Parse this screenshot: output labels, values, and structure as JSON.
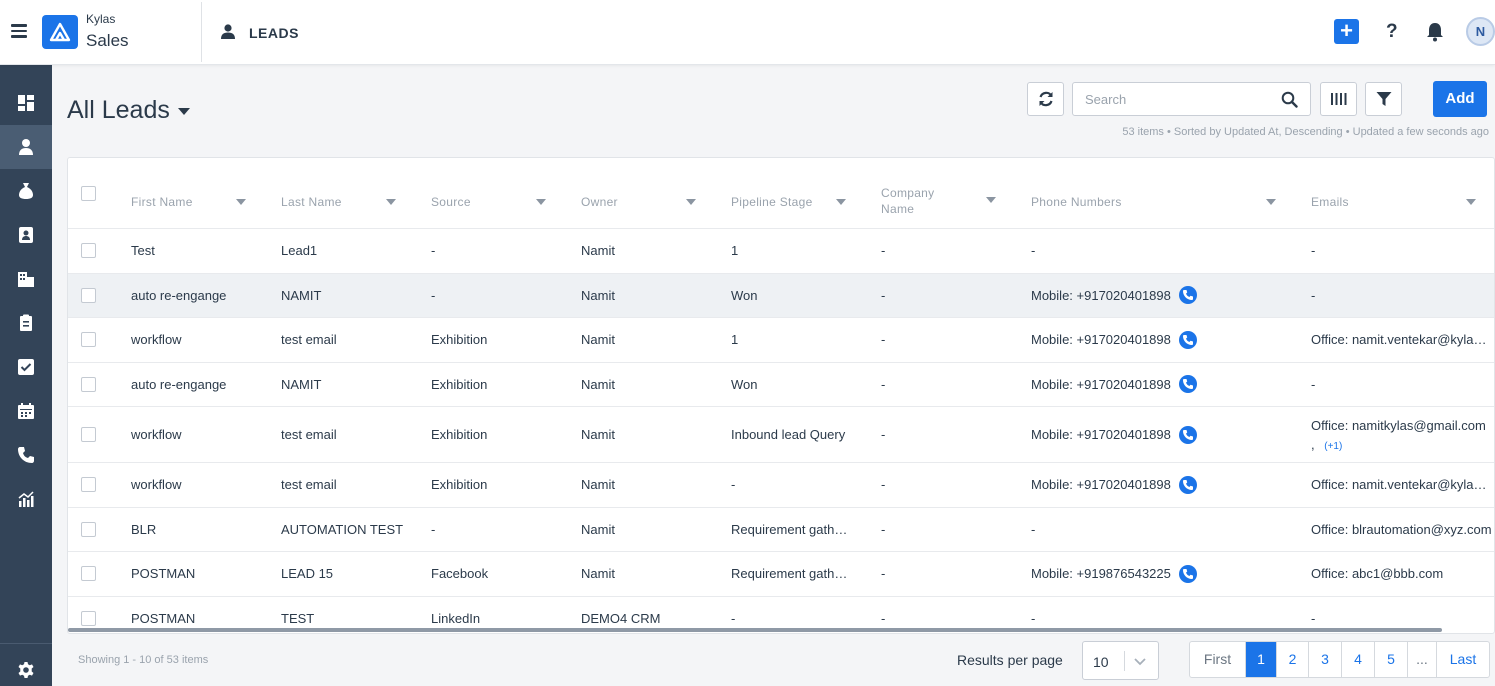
{
  "app": {
    "brand_top": "Kylas",
    "brand_bottom": "Sales",
    "module_title": "LEADS",
    "avatar_initial": "N"
  },
  "icons": {
    "menu": "hamburger-icon",
    "logo": "kylas-logo",
    "module": "person-icon",
    "quick_add": "plus-icon",
    "help": "question-icon",
    "notifications": "bell-icon",
    "refresh": "refresh-icon",
    "search": "search-icon",
    "columns": "columns-icon",
    "filter": "filter-icon",
    "phone": "phone-icon"
  },
  "colors": {
    "accent": "#1b74e8",
    "sidebar": "#334458",
    "sidebar_active": "#4a5d73"
  },
  "sidebar": {
    "items": [
      {
        "icon": "dashboard-icon"
      },
      {
        "icon": "leads-icon",
        "active": true
      },
      {
        "icon": "deals-icon"
      },
      {
        "icon": "contacts-icon"
      },
      {
        "icon": "companies-icon"
      },
      {
        "icon": "clipboard-icon"
      },
      {
        "icon": "tasks-icon"
      },
      {
        "icon": "calendar-icon"
      },
      {
        "icon": "calls-icon"
      },
      {
        "icon": "reports-icon"
      }
    ],
    "bottom_icon": "settings-icon"
  },
  "header": {
    "view_title": "All Leads",
    "search_placeholder": "Search",
    "add_label": "Add",
    "meta": "53 items • Sorted by Updated At, Descending • Updated a few seconds ago"
  },
  "table": {
    "columns": [
      {
        "label": "First Name"
      },
      {
        "label": "Last Name"
      },
      {
        "label": "Source"
      },
      {
        "label": "Owner"
      },
      {
        "label": "Pipeline Stage"
      },
      {
        "label": "Company Name"
      },
      {
        "label": "Phone Numbers"
      },
      {
        "label": "Emails"
      }
    ],
    "rows": [
      {
        "first": "Test",
        "last": "Lead1",
        "source": "-",
        "owner": "Namit",
        "stage": "1",
        "company": "-",
        "phone": "-",
        "email": "-",
        "email_more": "",
        "phone_icon": false
      },
      {
        "first": "auto re-engange",
        "last": "NAMIT",
        "source": "-",
        "owner": "Namit",
        "stage": "Won",
        "company": "-",
        "phone": "Mobile: +917020401898",
        "email": "-",
        "email_more": "",
        "phone_icon": true,
        "hover": true
      },
      {
        "first": "workflow",
        "last": "test email",
        "source": "Exhibition",
        "owner": "Namit",
        "stage": "1",
        "company": "-",
        "phone": "Mobile: +917020401898",
        "email": "Office: namit.ventekar@kylas.io",
        "email_more": "",
        "phone_icon": true
      },
      {
        "first": "auto re-engange",
        "last": "NAMIT",
        "source": "Exhibition",
        "owner": "Namit",
        "stage": "Won",
        "company": "-",
        "phone": "Mobile: +917020401898",
        "email": "-",
        "email_more": "",
        "phone_icon": true
      },
      {
        "first": "workflow",
        "last": "test email",
        "source": "Exhibition",
        "owner": "Namit",
        "stage": "Inbound lead Query",
        "company": "-",
        "phone": "Mobile: +917020401898",
        "email": "Office: namitkylas@gmail.com",
        "email_more": "(+1)",
        "phone_icon": true,
        "tall": true
      },
      {
        "first": "workflow",
        "last": "test email",
        "source": "Exhibition",
        "owner": "Namit",
        "stage": "-",
        "company": "-",
        "phone": "Mobile: +917020401898",
        "email": "Office: namit.ventekar@kylas.io",
        "email_more": "",
        "phone_icon": true
      },
      {
        "first": "BLR",
        "last": "AUTOMATION TEST",
        "source": "-",
        "owner": "Namit",
        "stage": "Requirement gathering",
        "company": "-",
        "phone": "-",
        "email": "Office: blrautomation@xyz.com",
        "email_more": "",
        "phone_icon": false
      },
      {
        "first": "POSTMAN",
        "last": "LEAD 15",
        "source": "Facebook",
        "owner": "Namit",
        "stage": "Requirement gathering",
        "company": "-",
        "phone": "Mobile: +919876543225",
        "email": "Office: abc1@bbb.com",
        "email_more": "",
        "phone_icon": true
      },
      {
        "first": "POSTMAN",
        "last": "TEST",
        "source": "LinkedIn",
        "owner": "DEMO4 CRM",
        "stage": "-",
        "company": "-",
        "phone": "-",
        "email": "-",
        "email_more": "",
        "phone_icon": false
      }
    ]
  },
  "footer": {
    "showing": "Showing 1 - 10 of 53 items",
    "results_label": "Results per page",
    "page_size": "10",
    "pager": [
      "First",
      "1",
      "2",
      "3",
      "4",
      "5",
      "...",
      "Last"
    ],
    "current_page": "1"
  }
}
